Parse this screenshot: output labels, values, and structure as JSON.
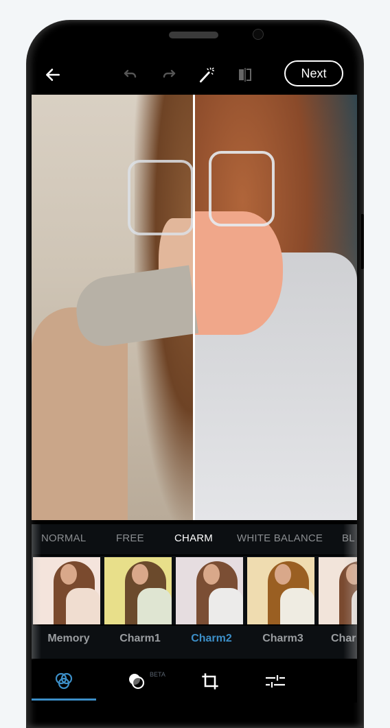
{
  "toolbar": {
    "back_icon": "arrow-left-icon",
    "undo_icon": "undo-icon",
    "redo_icon": "redo-icon",
    "magic_icon": "magic-wand-icon",
    "compare_icon": "compare-icon",
    "next_label": "Next"
  },
  "categories": [
    {
      "label": "NORMAL",
      "active": false
    },
    {
      "label": "FREE",
      "active": false
    },
    {
      "label": "CHARM",
      "active": true
    },
    {
      "label": "WHITE BALANCE",
      "active": false
    },
    {
      "label": "BL",
      "active": false
    }
  ],
  "filters": [
    {
      "name": "Memory",
      "active": false,
      "bg": "#f4e4dc",
      "shirt": "#f0ddd0",
      "hair": "#7a4a2e"
    },
    {
      "name": "Charm1",
      "active": false,
      "bg": "#e8df8a",
      "shirt": "#dfe5d2",
      "hair": "#6b4a2c"
    },
    {
      "name": "Charm2",
      "active": true,
      "bg": "#e6dde0",
      "shirt": "#ecebea",
      "hair": "#7b4e34"
    },
    {
      "name": "Charm3",
      "active": false,
      "bg": "#efdcb0",
      "shirt": "#efece2",
      "hair": "#9a5f22"
    },
    {
      "name": "Char",
      "active": false,
      "bg": "#f2e4da",
      "shirt": "#eee6e0",
      "hair": "#7a4a30"
    }
  ],
  "bottom_nav": [
    {
      "icon": "filters-icon",
      "active": true
    },
    {
      "icon": "overlay-icon",
      "badge": "BETA",
      "active": false
    },
    {
      "icon": "crop-icon",
      "active": false
    },
    {
      "icon": "adjust-icon",
      "active": false
    }
  ],
  "colors": {
    "accent": "#3c8fc8",
    "panel_bg": "#0c0f12",
    "bar_bg": "#000000"
  }
}
